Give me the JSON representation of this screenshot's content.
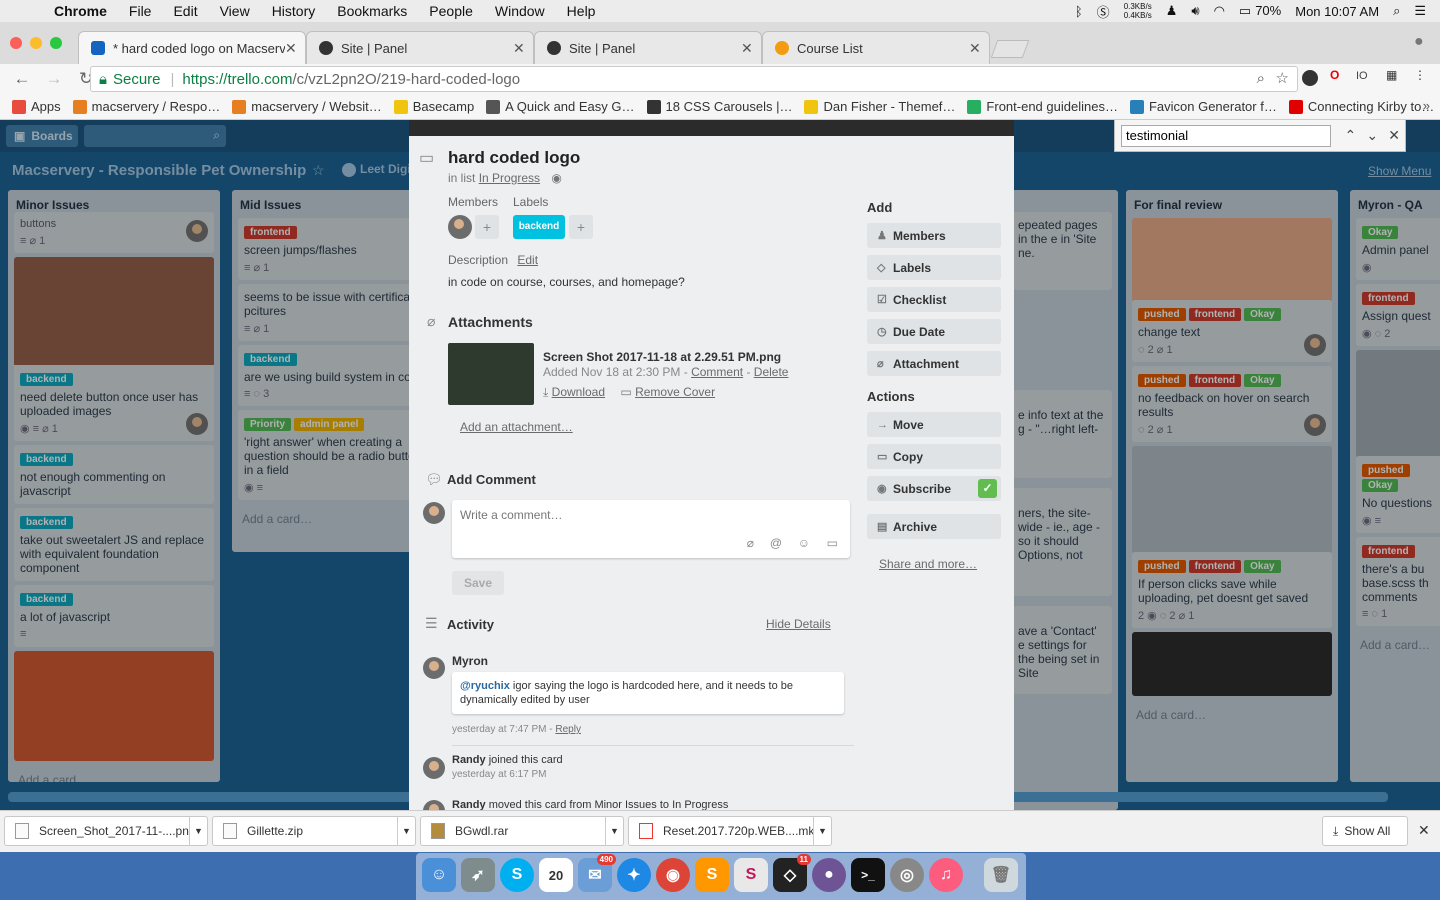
{
  "menubar": {
    "app": "Chrome",
    "items": [
      "File",
      "Edit",
      "View",
      "History",
      "Bookmarks",
      "People",
      "Window",
      "Help"
    ],
    "net_up": "0.3KB/s",
    "net_down": "0.4KB/s",
    "battery": "70%",
    "clock": "Mon 10:07 AM"
  },
  "tabs": [
    {
      "label": "* hard coded logo on Macserv…",
      "active": true,
      "icon_color": "#1565c0"
    },
    {
      "label": "Site | Panel",
      "active": false,
      "icon_color": "#333333"
    },
    {
      "label": "Site | Panel",
      "active": false,
      "icon_color": "#333333"
    },
    {
      "label": "Course List",
      "active": false,
      "icon_color": "#f39c12"
    }
  ],
  "address": {
    "secure_label": "Secure",
    "url_host": "https://trello.com",
    "url_path": "/c/vzL2pn2O/219-hard-coded-logo"
  },
  "bookmarks": [
    {
      "label": "Apps",
      "icon_color": "#e74c3c"
    },
    {
      "label": "macservery / Respo…",
      "icon_color": "#e67e22"
    },
    {
      "label": "macservery / Websit…",
      "icon_color": "#e67e22"
    },
    {
      "label": "Basecamp",
      "icon_color": "#f1c40f"
    },
    {
      "label": "A Quick and Easy G…",
      "icon_color": "#555555"
    },
    {
      "label": "18 CSS Carousels |…",
      "icon_color": "#333333"
    },
    {
      "label": "Dan Fisher - Themef…",
      "icon_color": "#f1c40f"
    },
    {
      "label": "Front-end guidelines…",
      "icon_color": "#27ae60"
    },
    {
      "label": "Favicon Generator f…",
      "icon_color": "#2980b9"
    },
    {
      "label": "Connecting Kirby to…",
      "icon_color": "#e00000"
    }
  ],
  "find": {
    "query": "testimonial"
  },
  "board": {
    "boards_label": "Boards",
    "title": "Macservery - Responsible Pet Ownership",
    "team": "Leet Digit",
    "show_menu": "Show Menu",
    "lists": [
      {
        "title": "Minor Issues",
        "cards": [
          {
            "labels": [],
            "text": "buttons",
            "badges": "≡  ⌀ 1"
          },
          {
            "labels": [
              {
                "name": "backend",
                "color": "#0c9fb5"
              }
            ],
            "text": "need delete button once user has uploaded images",
            "badges": "◉  ≡  ⌀ 1",
            "image": true
          },
          {
            "labels": [
              {
                "name": "backend",
                "color": "#0c9fb5"
              }
            ],
            "text": "not enough commenting on javascript",
            "badges": ""
          },
          {
            "labels": [
              {
                "name": "backend",
                "color": "#0c9fb5"
              }
            ],
            "text": "take out sweetalert JS and replace with equivalent foundation component",
            "badges": ""
          },
          {
            "labels": [
              {
                "name": "backend",
                "color": "#0c9fb5"
              }
            ],
            "text": "a lot of javascript",
            "badges": "≡"
          }
        ],
        "add": "Add a card…"
      },
      {
        "title": "Mid Issues",
        "cards": [
          {
            "labels": [
              {
                "name": "frontend",
                "color": "#c0392b"
              }
            ],
            "text": "screen jumps/flashes",
            "badges": "≡  ⌀ 1"
          },
          {
            "labels": [],
            "text": "seems to be issue with certificate pcitures",
            "badges": "≡  ⌀ 1"
          },
          {
            "labels": [
              {
                "name": "backend",
                "color": "#0c9fb5"
              }
            ],
            "text": "are we using build system in code",
            "badges": "≡  ◌ 3"
          },
          {
            "labels": [
              {
                "name": "Priority",
                "color": "#4caf50"
              },
              {
                "name": "admin panel",
                "color": "#e0a800"
              }
            ],
            "text": "'right answer' when creating a question should be a radio button in a field",
            "badges": "◉  ≡"
          }
        ],
        "add": "Add a card…"
      },
      {
        "title": "For final review",
        "cards": [
          {
            "labels": [
              {
                "name": "pushed",
                "color": "#d35400"
              },
              {
                "name": "frontend",
                "color": "#c0392b"
              },
              {
                "name": "Okay",
                "color": "#4caf50"
              }
            ],
            "text": "change text",
            "badges": "◌ 2  ⌀ 1",
            "image": true
          },
          {
            "labels": [
              {
                "name": "pushed",
                "color": "#d35400"
              },
              {
                "name": "frontend",
                "color": "#c0392b"
              },
              {
                "name": "Okay",
                "color": "#4caf50"
              }
            ],
            "text": "no feedback on hover on search results",
            "badges": "◌ 2  ⌀ 1"
          },
          {
            "labels": [
              {
                "name": "pushed",
                "color": "#d35400"
              },
              {
                "name": "frontend",
                "color": "#c0392b"
              },
              {
                "name": "Okay",
                "color": "#4caf50"
              }
            ],
            "text": "If person clicks save while uploading, pet doesnt get saved",
            "badges": "2  ◉  ◌ 2  ⌀ 1",
            "image": true
          }
        ],
        "add": "Add a card…"
      },
      {
        "title": "Myron - QA",
        "cards": [
          {
            "labels": [
              {
                "name": "Okay",
                "color": "#4caf50"
              }
            ],
            "text": "Admin panel",
            "badges": "◉"
          },
          {
            "labels": [
              {
                "name": "frontend",
                "color": "#c0392b"
              }
            ],
            "text": "Assign quest",
            "badges": "◉  ◌ 2"
          },
          {
            "labels": [
              {
                "name": "pushed",
                "color": "#d35400"
              },
              {
                "name": "Okay",
                "color": "#4caf50"
              }
            ],
            "text": "No questions",
            "badges": "◉  ≡",
            "image": true
          },
          {
            "labels": [
              {
                "name": "frontend",
                "color": "#c0392b"
              }
            ],
            "text": "there's a bu base.scss th comments",
            "badges": "≡  ◌ 1"
          }
        ],
        "add": "Add a card…"
      }
    ],
    "partial_card_texts": [
      "epeated pages in the e in 'Site ne.",
      "e info text at the g - \"…right left-",
      "ners, the site-wide - ie., age - so it should Options, not",
      "ave a 'Contact' e settings for the being set in Site"
    ]
  },
  "modal": {
    "title": "hard coded logo",
    "in_list_prefix": "in list",
    "in_list": "In Progress",
    "members_heading": "Members",
    "labels_heading": "Labels",
    "label_name": "backend",
    "label_color": "#00c2e0",
    "description_heading": "Description",
    "description_edit": "Edit",
    "description": "in code on course, courses, and homepage?",
    "attachments_heading": "Attachments",
    "attachment": {
      "name": "Screen Shot 2017-11-18 at 2.29.51 PM.png",
      "added": "Added Nov 18 at 2:30 PM",
      "comment": "Comment",
      "delete": "Delete",
      "download": "Download",
      "remove_cover": "Remove Cover"
    },
    "add_attachment": "Add an attachment…",
    "add_comment_heading": "Add Comment",
    "comment_placeholder": "Write a comment…",
    "save": "Save",
    "activity_heading": "Activity",
    "hide_details": "Hide Details",
    "activity": [
      {
        "user": "Myron",
        "mention": "@ryuchix",
        "text": "igor saying the logo is hardcoded here, and it needs to be dynamically edited by user",
        "time": "yesterday at 7:47 PM",
        "reply": "Reply"
      },
      {
        "user": "Randy",
        "text": "joined this card",
        "time": "yesterday at 6:17 PM"
      },
      {
        "user": "Randy",
        "text": "moved this card from Minor Issues to In Progress"
      }
    ],
    "sidebar": {
      "add_heading": "Add",
      "add_buttons": [
        {
          "label": "Members",
          "icon": "person-icon"
        },
        {
          "label": "Labels",
          "icon": "tag-icon"
        },
        {
          "label": "Checklist",
          "icon": "checklist-icon"
        },
        {
          "label": "Due Date",
          "icon": "clock-icon"
        },
        {
          "label": "Attachment",
          "icon": "paperclip-icon"
        }
      ],
      "actions_heading": "Actions",
      "action_buttons": [
        {
          "label": "Move",
          "icon": "arrow-icon"
        },
        {
          "label": "Copy",
          "icon": "copy-icon"
        },
        {
          "label": "Subscribe",
          "icon": "eye-icon"
        },
        {
          "label": "Archive",
          "icon": "archive-icon"
        }
      ],
      "share": "Share and more…"
    }
  },
  "downloads": [
    {
      "name": "Screen_Shot_2017-11-....png"
    },
    {
      "name": "Gillette.zip"
    },
    {
      "name": "BGwdl.rar"
    },
    {
      "name": "Reset.2017.720p.WEB....mkv"
    }
  ],
  "show_all": "Show All",
  "dock": [
    {
      "name": "finder-icon",
      "color": "#4a90d9"
    },
    {
      "name": "launchpad-icon",
      "color": "#7f8c8d"
    },
    {
      "name": "skype-icon",
      "color": "#00aff0",
      "glyph": "S"
    },
    {
      "name": "calendar-icon",
      "color": "#ffffff",
      "glyph": "20"
    },
    {
      "name": "mail-icon",
      "color": "#6b9dd6",
      "badge": "490"
    },
    {
      "name": "safari-icon",
      "color": "#1e88e5"
    },
    {
      "name": "chrome-icon",
      "color": "#db4437"
    },
    {
      "name": "sublime-icon",
      "color": "#ff9800"
    },
    {
      "name": "slack-icon",
      "color": "#e8e8e8",
      "glyph": "S"
    },
    {
      "name": "sourcetree-icon",
      "color": "#222222",
      "badge": "11"
    },
    {
      "name": "github-icon",
      "color": "#6e5494"
    },
    {
      "name": "terminal-icon",
      "color": "#111111"
    },
    {
      "name": "sequel-icon",
      "color": "#888888"
    },
    {
      "name": "itunes-icon",
      "color": "#fc5c7d"
    },
    {
      "name": "trash-icon",
      "color": "#cfd8dc"
    }
  ]
}
